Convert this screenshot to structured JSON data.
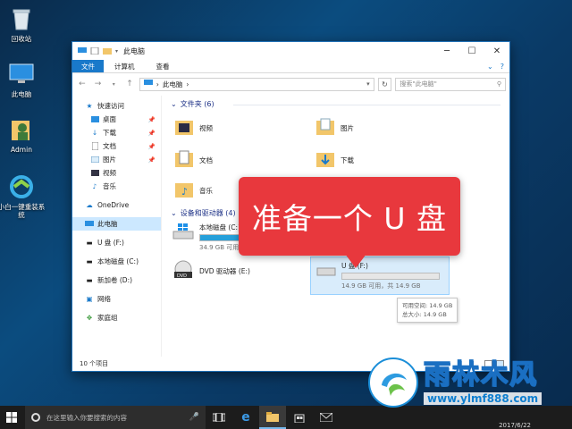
{
  "desktop": {
    "icons": [
      {
        "label": "回收站"
      },
      {
        "label": "此电脑"
      },
      {
        "label": "Admin"
      },
      {
        "label": "小白一键重装系统"
      }
    ]
  },
  "window": {
    "title": "此电脑",
    "ribbon_tabs": [
      "文件",
      "计算机",
      "查看"
    ],
    "address_path": "此电脑",
    "search_placeholder": "搜索\"此电脑\"",
    "sidebar": {
      "quick_access": "快速访问",
      "quick_items": [
        "桌面",
        "下载",
        "文档",
        "图片",
        "视频",
        "音乐"
      ],
      "onedrive": "OneDrive",
      "this_pc": "此电脑",
      "drives": [
        "U 盘 (F:)",
        "本地磁盘 (C:)",
        "新加卷 (D:)"
      ],
      "network": "网络",
      "homegroup": "家庭组"
    },
    "folders_header": "文件夹 (6)",
    "folders": [
      "视频",
      "图片",
      "文档",
      "下载",
      "音乐"
    ],
    "devices_header": "设备和驱动器 (4)",
    "drives": [
      {
        "name": "本地磁盘 (C:)",
        "free": "34.9 GB 可用",
        "used_fraction": 0.55
      },
      {
        "name": "DVD 驱动器 (E:)"
      },
      {
        "name": "U 盘 (F:)",
        "free": "14.9 GB 可用，共 14.9 GB",
        "used_fraction": 0.0
      }
    ],
    "tooltip": {
      "line1": "可用空间: 14.9 GB",
      "line2": "总大小: 14.9 GB"
    },
    "status": "10 个项目"
  },
  "callout": "准备一个 U 盘",
  "taskbar": {
    "search_placeholder": "在这里输入你要搜索的内容",
    "date": "2017/6/22"
  },
  "watermark": {
    "name": "雨林木风",
    "url": "www.ylmf888.com"
  },
  "colors": {
    "accent": "#1979ca",
    "callout": "#e8383d",
    "taskbar": "#1c1c1c"
  }
}
